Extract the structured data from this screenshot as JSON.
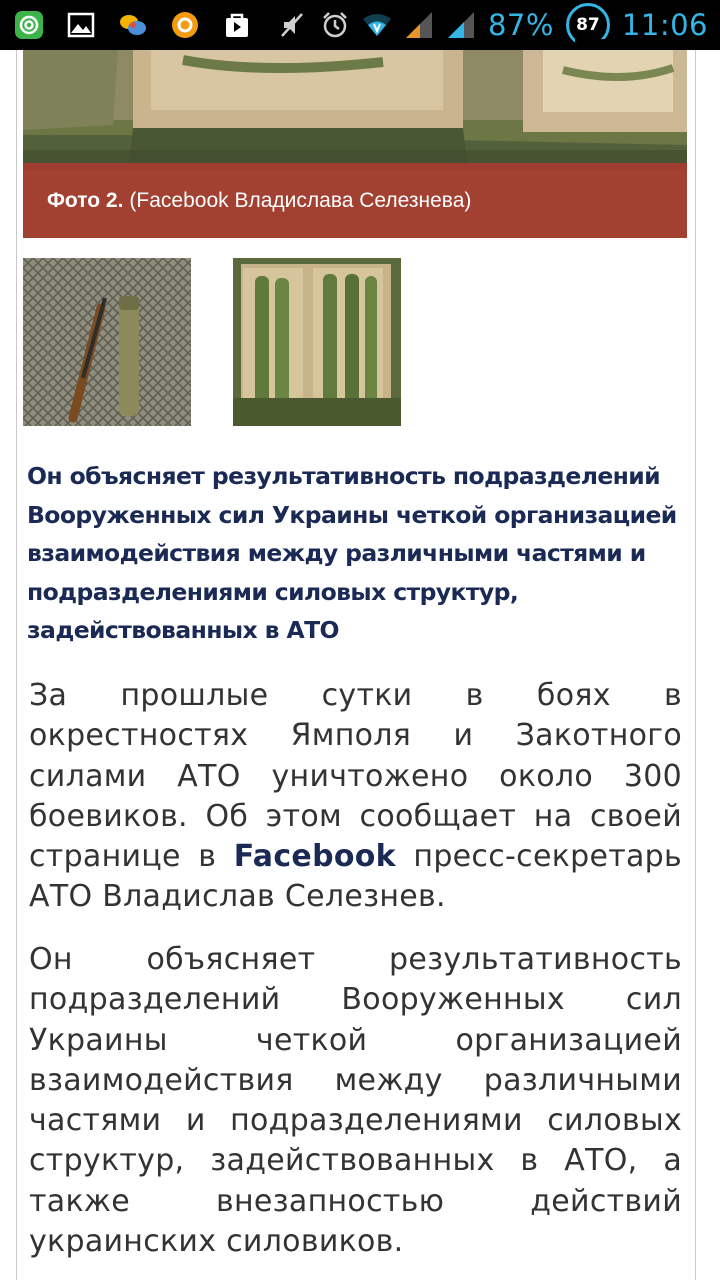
{
  "status_bar": {
    "battery_percent": "87%",
    "battery_badge": "87",
    "time": "11:06",
    "icons": [
      "at-sign-icon",
      "image-icon",
      "chat-bubbles-icon",
      "app-circle-icon",
      "shopping-bag-icon",
      "mute-icon",
      "alarm-icon",
      "wifi-icon",
      "signal-icon",
      "signal-icon"
    ]
  },
  "photo": {
    "caption_bold": "Фото 2.",
    "caption_rest": "(Facebook Владислава Селезнева)"
  },
  "lead_text": "Он объясняет результативность подразделений Вооруженных сил Украины четкой организацией взаимодействия между различными частями и подразделениями силовых структур, задействованных в АТО",
  "paragraph_1": {
    "before_link": "За прошлые сутки в боях в окрестностях Ямполя и Закотного силами АТО уничтожено около 300 боевиков. Об этом сообщает на своей странице в",
    "link": "Facebook",
    "after_link": "пресс-секретарь АТО Владислав Селезнев."
  },
  "paragraph_2": "Он объясняет результативность подразделений Вооруженных сил Украины четкой организацией взаимодействия между различными частями и подразделениями силовых структур, задействованных в АТО, а также внезапностью действий украинских силовиков."
}
